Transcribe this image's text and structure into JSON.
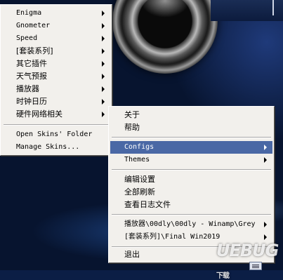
{
  "main_menu": {
    "items": [
      {
        "label": "Enigma",
        "submenu": true
      },
      {
        "label": "Gnometer",
        "submenu": true
      },
      {
        "label": "Speed",
        "submenu": true
      },
      {
        "label": "[套装系列]",
        "submenu": true
      },
      {
        "label": "其它插件",
        "submenu": true
      },
      {
        "label": "天气预报",
        "submenu": true
      },
      {
        "label": "播放器",
        "submenu": true
      },
      {
        "label": "时钟日历",
        "submenu": true
      },
      {
        "label": "硬件网络相关",
        "submenu": true
      }
    ],
    "open_skins_folder": "Open Skins' Folder",
    "manage_skins": "Manage Skins..."
  },
  "context_menu": {
    "about": "关于",
    "help": "帮助",
    "configs": "Configs",
    "themes": "Themes",
    "edit_settings": "编辑设置",
    "refresh_all": "全部刷新",
    "view_log": "查看日志文件",
    "active_skin_1": "播放器\\00dly\\00dly - Winamp\\Grey",
    "active_skin_2": "[套装系列]\\Final Win2019",
    "exit": "退出"
  },
  "watermark": {
    "text": "UEBUG",
    "suffix": "下载"
  },
  "colors": {
    "highlight": "#4a68a5",
    "menu_bg": "#f2f0ec"
  }
}
